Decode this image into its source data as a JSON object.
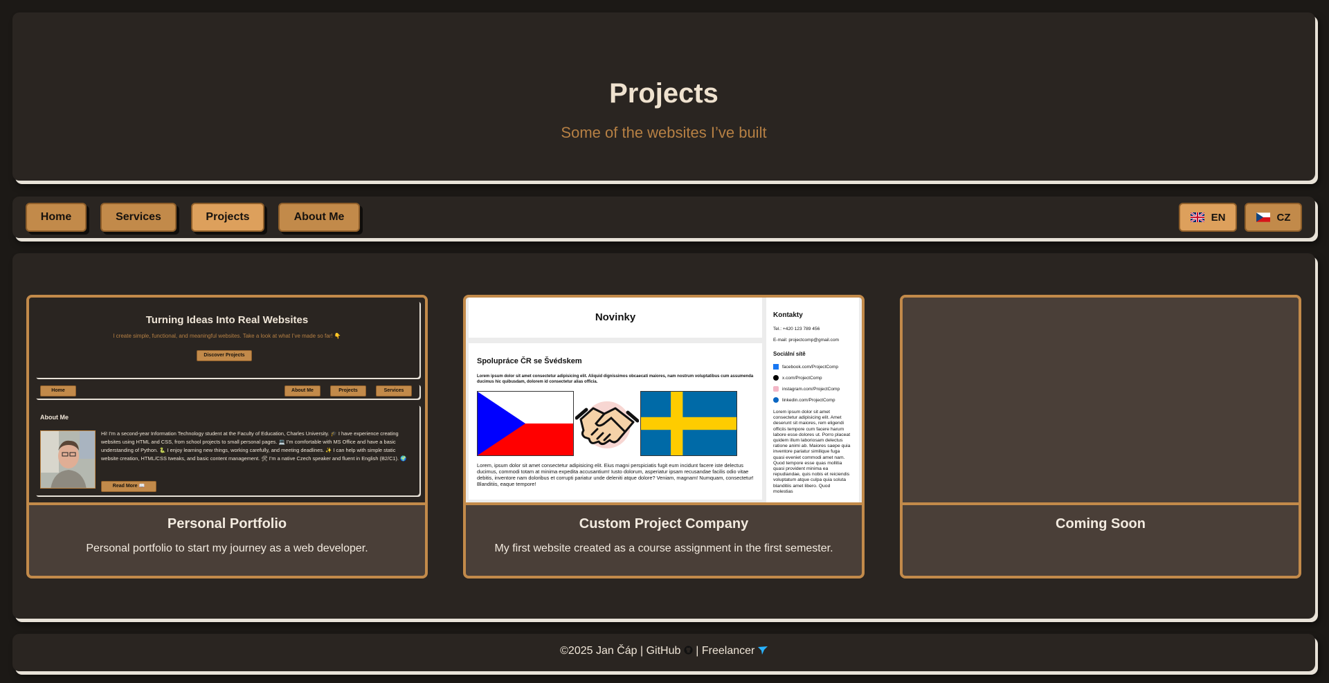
{
  "header": {
    "title": "Projects",
    "subtitle": "Some of the websites I’ve built"
  },
  "nav": {
    "items": [
      {
        "label": "Home"
      },
      {
        "label": "Services"
      },
      {
        "label": "Projects",
        "active": true
      },
      {
        "label": "About Me"
      }
    ],
    "languages": [
      {
        "label": "EN",
        "flag": "uk-flag-icon",
        "active": true
      },
      {
        "label": "CZ",
        "flag": "czech-flag-icon"
      }
    ]
  },
  "projects": [
    {
      "title": "Personal Portfolio",
      "description": "Personal portfolio to start my journey as a web developer.",
      "preview": {
        "hero_title": "Turning Ideas Into Real Websites",
        "hero_text": "I create simple, functional, and meaningful websites. Take a look at what I’ve made so far! 👇",
        "hero_button": "Discover Projects",
        "nav_home": "Home",
        "nav_about": "About Me",
        "nav_projects": "Projects",
        "nav_services": "Services",
        "about_title": "About Me",
        "about_text": "Hi! I’m a second-year Information Technology student at the Faculty of Education, Charles University. 🎓 I have experience creating websites using HTML and CSS, from school projects to small personal pages. 💻 I’m comfortable with MS Office and have a basic understanding of Python. 🐍 I enjoy learning new things, working carefully, and meeting deadlines. ✨ I can help with simple static website creation, HTML/CSS tweaks, and basic content management. 🛠 I’m a native Czech speaker and fluent in English (B2/C1). 🌍",
        "about_button": "Read More 📖"
      }
    },
    {
      "title": "Custom Project Company",
      "description": "My first website created as a course assignment in the first semester.",
      "preview": {
        "news_title": "Novinky",
        "article_title": "Spolupráce ČR se Švédskem",
        "article_bold": "Lorem ipsum dolor sit amet consectetur adipisicing elit. Aliquid dignissimos obcaecati maiores, nam nostrum voluptatibus cum assumenda ducimus hic quibusdam, dolorem id consectetur alias officia.",
        "article_text": "Lorem, ipsum dolor sit amet consectetur adipisicing elit. Eius magni perspiciatis fugit eum incidunt facere iste delectus ducimus, commodi totam at minima expedita accusantium! Iusto dolorum, asperiatur ipsam recusandae facilis odio vitae debitis, inventore nam doloribus et corrupti pariatur unde deleniti atque dolore? Veniam, magnam! Numquam, consectetur! Blanditiis, eaque tempore!",
        "contacts_title": "Kontakty",
        "phone": "Tel.: +420 123 789 456",
        "email": "E-mail: projectcomp@gmail.com",
        "social_title": "Sociální sítě",
        "social": [
          {
            "icon": "facebook-icon",
            "label": "facebook.com/ProjectComp"
          },
          {
            "icon": "x-icon",
            "label": "x.com/ProjectComp"
          },
          {
            "icon": "instagram-icon",
            "label": "instagram.com/ProjectComp"
          },
          {
            "icon": "linkedin-icon",
            "label": "linkedin.com/ProjectComp"
          }
        ],
        "sidebar_text": "Lorem ipsum dolor sit amet consectetur adipisicing elit. Amet deserunt sit maiores, rem eligendi officiis tempore cum facere harum labore esse dolores ut. Porro placeat quidem illum laboriosam delectus ratione animi ab. Maiores saepe quia inventore pariatur similique fuga quasi eveniet commodi amet nam. Quod tempore esse quas mollitia quasi provident minima ea repudiandae, quis nobis et reiciendis voluptatum atque culpa quia soluta blanditiis amet libero. Quod molestias"
      }
    },
    {
      "title": "Coming Soon",
      "description": ""
    }
  ],
  "footer": {
    "copyright": "©2025 Jan Čáp",
    "sep1": " | ",
    "github": "GitHub",
    "sep2": " | ",
    "freelancer": "Freelancer"
  },
  "colors": {
    "background": "#1c1916",
    "panel": "#2a2521",
    "accent": "#c28a4a",
    "subtitle": "#b68044",
    "card_body": "#4a3f38"
  }
}
